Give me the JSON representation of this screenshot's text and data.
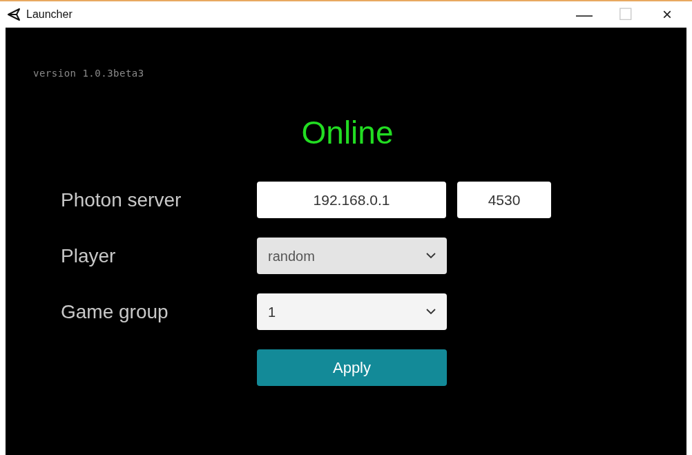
{
  "window": {
    "title": "Launcher",
    "controls": [
      "—",
      "☐",
      "×"
    ]
  },
  "version": "version 1.0.3beta3",
  "status": {
    "text": "Online",
    "color": "#22dd22"
  },
  "form": {
    "rows": [
      {
        "kind": "fields",
        "label": "Photon server",
        "values": [
          "192.168.0.1",
          "4530"
        ]
      },
      {
        "kind": "dropdown",
        "label": "Player",
        "value": "random",
        "disabled": true
      },
      {
        "kind": "dropdown",
        "label": "Game group",
        "value": "1",
        "disabled": false
      }
    ]
  },
  "apply_button": "Apply"
}
